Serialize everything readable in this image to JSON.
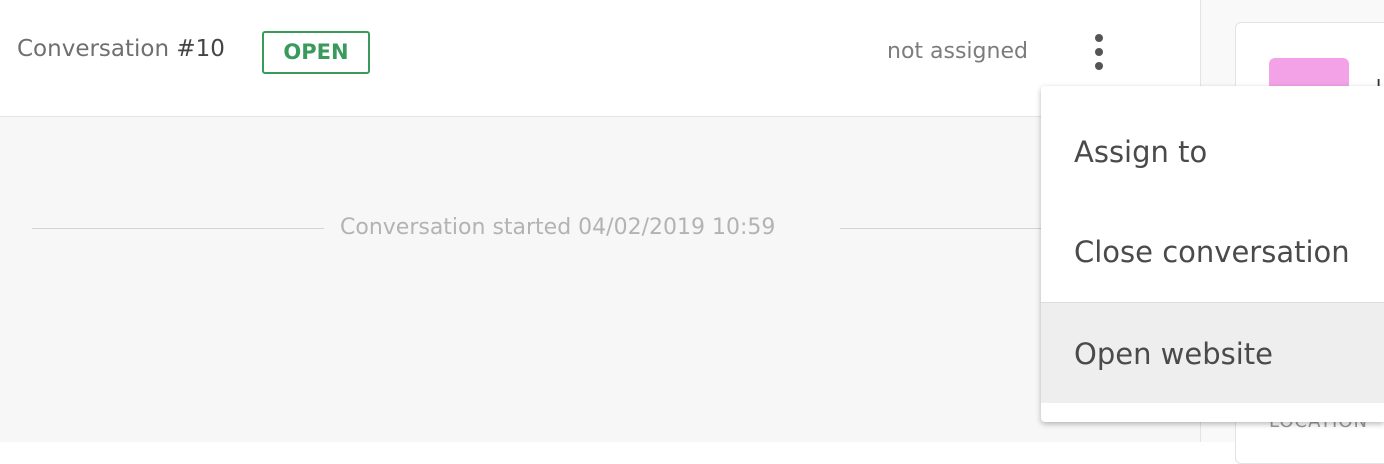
{
  "conversation": {
    "title_prefix": "Conversation",
    "number": "#10",
    "status": "OPEN",
    "assignee": "not assigned"
  },
  "timeline": {
    "started_text": "Conversation started 04/02/2019 10:59"
  },
  "dropdown": {
    "items": [
      {
        "label": "Assign to"
      },
      {
        "label": "Close conversation"
      },
      {
        "label": "Open website",
        "hovered": true
      }
    ]
  },
  "sidebar": {
    "section_label": "LOCATION",
    "avatar_color": "#f4a2e8"
  },
  "colors": {
    "status_green": "#3a9a5c",
    "background": "#f7f7f7"
  },
  "icons": {
    "menu": "kebab-menu-icon"
  }
}
